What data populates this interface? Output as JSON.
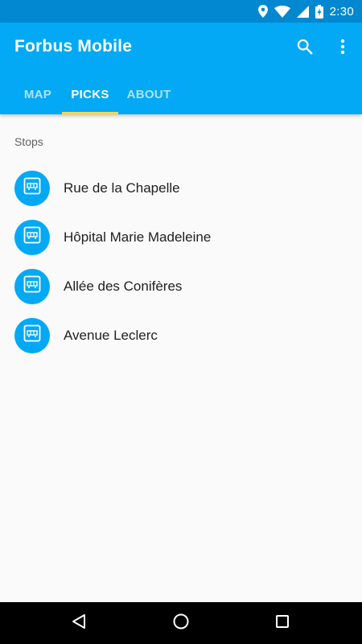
{
  "status_bar": {
    "time": "2:30",
    "icons": [
      "location-icon",
      "wifi-icon",
      "signal-icon",
      "battery-charging-icon"
    ]
  },
  "app_bar": {
    "title": "Forbus Mobile",
    "actions": [
      "search-icon",
      "more-vert-icon"
    ],
    "color": "#03a9f4"
  },
  "tabs": [
    {
      "label": "MAP",
      "active": false
    },
    {
      "label": "PICKS",
      "active": true
    },
    {
      "label": "ABOUT",
      "active": false
    }
  ],
  "tab_indicator_color": "#ffd740",
  "section": {
    "header": "Stops"
  },
  "stops": [
    {
      "name": "Rue de la Chapelle",
      "icon": "bus-icon"
    },
    {
      "name": "Hôpital Marie Madeleine",
      "icon": "bus-icon"
    },
    {
      "name": "Allée des Conifères",
      "icon": "bus-icon"
    },
    {
      "name": "Avenue Leclerc",
      "icon": "bus-icon"
    }
  ],
  "nav_bar": {
    "buttons": [
      "back-icon",
      "home-icon",
      "recents-icon"
    ]
  }
}
